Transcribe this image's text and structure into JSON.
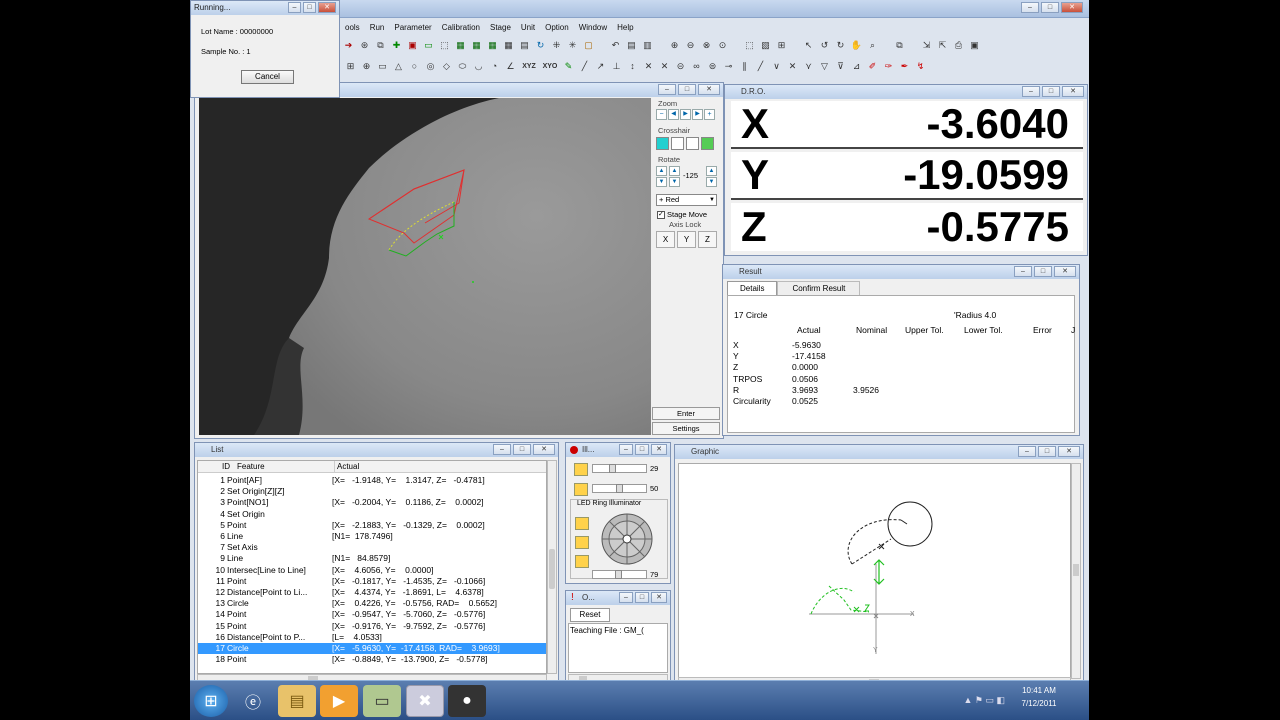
{
  "running_dialog": {
    "title": "Running...",
    "lot_name": "Lot Name : 00000000",
    "sample_no": "Sample No. : 1",
    "cancel": "Cancel"
  },
  "menu": [
    "ools",
    "Run",
    "Parameter",
    "Calibration",
    "Stage",
    "Unit",
    "Option",
    "Window",
    "Help"
  ],
  "video_panel": {
    "zoom_label": "Zoom",
    "crosshair_label": "Crosshair",
    "rotate_label": "Rotate",
    "rotate_value": "-125",
    "color_select": "+ Red",
    "stage_move": "Stage Move",
    "axis_lock": "Axis Lock",
    "axis_buttons": [
      "X",
      "Y",
      "Z"
    ],
    "enter": "Enter",
    "settings": "Settings"
  },
  "dro": {
    "title": "D.R.O.",
    "rows": [
      {
        "axis": "X",
        "value": "-3.6040"
      },
      {
        "axis": "Y",
        "value": "-19.0599"
      },
      {
        "axis": "Z",
        "value": "-0.5775"
      }
    ]
  },
  "result": {
    "title": "Result",
    "tabs": [
      "Details",
      "Confirm Result"
    ],
    "feature": "17   Circle",
    "radius_label": "'Radius 4.0",
    "headers": [
      "Actual",
      "Nominal",
      "Upper Tol.",
      "Lower Tol.",
      "Error",
      "J"
    ],
    "rows": [
      {
        "name": "X",
        "actual": "-5.9630",
        "nominal": ""
      },
      {
        "name": "Y",
        "actual": "-17.4158",
        "nominal": ""
      },
      {
        "name": "Z",
        "actual": "0.0000",
        "nominal": ""
      },
      {
        "name": "TRPOS",
        "actual": "0.0506",
        "nominal": ""
      },
      {
        "name": "R",
        "actual": "3.9693",
        "nominal": "3.9526"
      },
      {
        "name": "Circularity",
        "actual": "0.0525",
        "nominal": ""
      }
    ]
  },
  "list": {
    "title": "List",
    "headers": [
      "ID",
      "Feature",
      "Actual"
    ],
    "rows": [
      {
        "id": "1",
        "feature": "Point[AF]",
        "actual": "[X=   -1.9148, Y=    1.3147, Z=   -0.4781]"
      },
      {
        "id": "2",
        "feature": "Set Origin[Z][Z]",
        "actual": ""
      },
      {
        "id": "3",
        "feature": "Point[NO1]",
        "actual": "[X=   -0.2004, Y=    0.1186, Z=    0.0002]"
      },
      {
        "id": "4",
        "feature": "Set Origin",
        "actual": ""
      },
      {
        "id": "5",
        "feature": "Point",
        "actual": "[X=   -2.1883, Y=   -0.1329, Z=    0.0002]"
      },
      {
        "id": "6",
        "feature": "Line",
        "actual": "[N1=  178.7496]"
      },
      {
        "id": "7",
        "feature": "Set Axis",
        "actual": ""
      },
      {
        "id": "9",
        "feature": "Line",
        "actual": "[N1=   84.8579]"
      },
      {
        "id": "10",
        "feature": "Intersec[Line to Line]",
        "actual": "[X=    4.6056, Y=    0.0000]"
      },
      {
        "id": "11",
        "feature": "Point",
        "actual": "[X=   -0.1817, Y=   -1.4535, Z=   -0.1066]"
      },
      {
        "id": "12",
        "feature": "Distance[Point to Li...",
        "actual": "[X=    4.4374, Y=   -1.8691, L=    4.6378]"
      },
      {
        "id": "13",
        "feature": "Circle",
        "actual": "[X=    0.4226, Y=   -0.5756, RAD=    0.5652]"
      },
      {
        "id": "14",
        "feature": "Point",
        "actual": "[X=   -0.9547, Y=   -5.7060, Z=   -0.5776]"
      },
      {
        "id": "15",
        "feature": "Point",
        "actual": "[X=   -0.9176, Y=   -9.7592, Z=   -0.5776]"
      },
      {
        "id": "16",
        "feature": "Distance[Point to P...",
        "actual": "[L=    4.0533]"
      },
      {
        "id": "17",
        "feature": "Circle",
        "actual": "[X=   -5.9630, Y=  -17.4158, RAD=    3.9693]"
      },
      {
        "id": "18",
        "feature": "Point",
        "actual": "[X=   -0.8849, Y=  -13.7900, Z=   -0.5778]"
      }
    ]
  },
  "illuminator": {
    "title": "Ill...",
    "slider1": "29",
    "slider2": "50",
    "led_label": "LED Ring Illuminator",
    "slider3": "79"
  },
  "teaching": {
    "title": "O...",
    "reset": "Reset",
    "file": "Teaching File : GM_("
  },
  "graphic": {
    "title": "Graphic"
  },
  "clock": {
    "time": "10:41 AM",
    "date": "7/12/2011"
  },
  "colors": {
    "accent": "#3399ff",
    "titlebar": "#bcd0ea",
    "taskbar": "#2b4f86"
  }
}
